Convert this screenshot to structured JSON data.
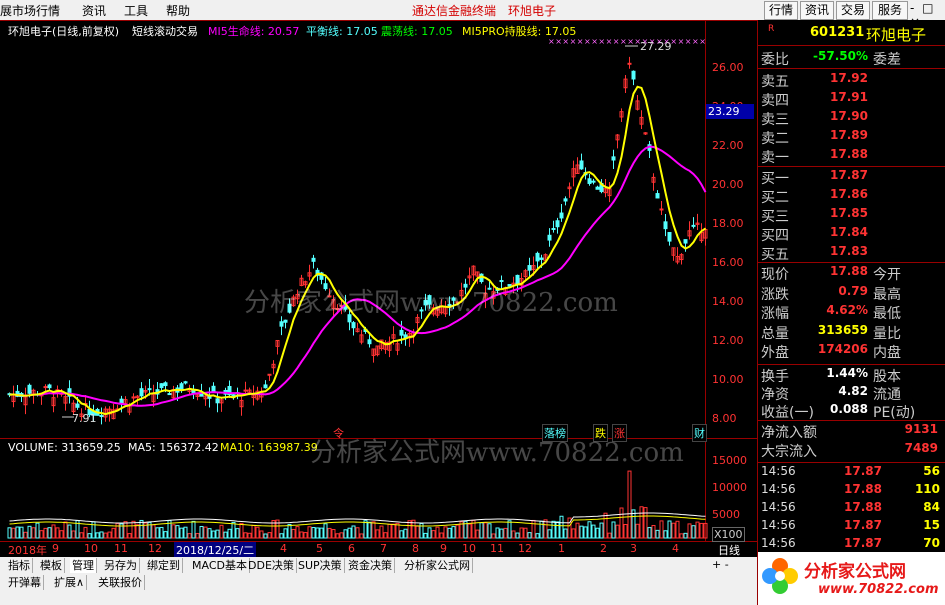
{
  "menubar": {
    "items": [
      "展市场行情",
      "资讯",
      "工具",
      "帮助"
    ],
    "brand": "通达信金融终端",
    "stock_title": "环旭电子",
    "buttons": [
      "行情",
      "资讯",
      "交易",
      "服务"
    ],
    "window_controls": "- □ ×"
  },
  "chart_header": {
    "name": "环旭电子(日线,前复权)",
    "indicator": "短线滚动交易",
    "mi5_life": "MI5生命线: 20.57",
    "balance": "平衡线: 17.05",
    "oscillate": "震荡线: 17.05",
    "hold": "MI5PRO持股线: 17.05"
  },
  "price_axis": [
    "26.00",
    "24.00",
    "22.00",
    "20.00",
    "18.00",
    "16.00",
    "14.00",
    "12.00",
    "10.00",
    "8.00"
  ],
  "price_marker": "23.29",
  "high_label": "27.29",
  "low_label": "7.91",
  "tags": {
    "rank": "落榜",
    "fall": "跌",
    "rise": "涨",
    "fin": "财",
    "sig": "令"
  },
  "volume_header": {
    "volume": "VOLUME: 313659.25",
    "ma5": "MA5: 156372.42",
    "ma10": "MA10: 163987.39"
  },
  "volume_axis": [
    "15000",
    "10000",
    "5000"
  ],
  "volume_unit": "X100",
  "time_axis": {
    "year_label": "2018年",
    "months_a": [
      "9",
      "10",
      "11",
      "12"
    ],
    "date_box": "2018/12/25/二",
    "months_b": [
      "4",
      "5",
      "6",
      "7",
      "8",
      "9",
      "10",
      "11",
      "12",
      "1",
      "2",
      "3",
      "4"
    ],
    "period": "日线"
  },
  "tabs_row1": [
    "指标",
    "模板",
    "管理",
    "另存为",
    "绑定到",
    "MACD基本",
    "DDE决策",
    "SUP决策",
    "资金决策",
    "分析家公式网"
  ],
  "tabs_row2": [
    "开弹幕",
    "扩展∧",
    "关联报价"
  ],
  "quote": {
    "code": "601231",
    "name": "环旭电子",
    "weibi_label": "委比",
    "weibi_value": "-57.50%",
    "weicha_label": "委差",
    "sells": [
      {
        "label": "卖五",
        "price": "17.92"
      },
      {
        "label": "卖四",
        "price": "17.91"
      },
      {
        "label": "卖三",
        "price": "17.90"
      },
      {
        "label": "卖二",
        "price": "17.89"
      },
      {
        "label": "卖一",
        "price": "17.88"
      }
    ],
    "buys": [
      {
        "label": "买一",
        "price": "17.87"
      },
      {
        "label": "买二",
        "price": "17.86"
      },
      {
        "label": "买三",
        "price": "17.85"
      },
      {
        "label": "买四",
        "price": "17.84"
      },
      {
        "label": "买五",
        "price": "17.83"
      }
    ],
    "stats": [
      {
        "l": "现价",
        "v": "17.88",
        "r": "今开",
        "c": "#ff3333"
      },
      {
        "l": "涨跌",
        "v": "0.79",
        "r": "最高",
        "c": "#ff3333"
      },
      {
        "l": "涨幅",
        "v": "4.62%",
        "r": "最低",
        "c": "#ff3333"
      },
      {
        "l": "总量",
        "v": "313659",
        "r": "量比",
        "c": "#ffff00"
      },
      {
        "l": "外盘",
        "v": "174206",
        "r": "内盘",
        "c": "#ff3333"
      }
    ],
    "stats2": [
      {
        "l": "换手",
        "v": "1.44%",
        "r": "股本",
        "c": "#ffffff"
      },
      {
        "l": "净资",
        "v": "4.82",
        "r": "流通",
        "c": "#ffffff"
      },
      {
        "l": "收益(一)",
        "v": "0.088",
        "r": "PE(动)",
        "c": "#ffffff"
      }
    ],
    "netflow_label": "净流入额",
    "netflow_value": "9131",
    "block_label": "大宗流入",
    "block_value": "7489",
    "ticks": [
      {
        "t": "14:56",
        "p": "17.87",
        "v": "56"
      },
      {
        "t": "14:56",
        "p": "17.88",
        "v": "110"
      },
      {
        "t": "14:56",
        "p": "17.88",
        "v": "84"
      },
      {
        "t": "14:56",
        "p": "17.87",
        "v": "15"
      },
      {
        "t": "14:56",
        "p": "17.87",
        "v": "70"
      }
    ]
  },
  "watermark": {
    "main": "分析家公式网www.70822.com",
    "logo": "分析家公式网",
    "logo_url": "www.70822.com"
  },
  "colors": {
    "up": "#ff3333",
    "down": "#54ffff",
    "ma_yellow": "#ffff00",
    "ma_magenta": "#ff00ff",
    "menu_bg": "#f0f0f0"
  }
}
